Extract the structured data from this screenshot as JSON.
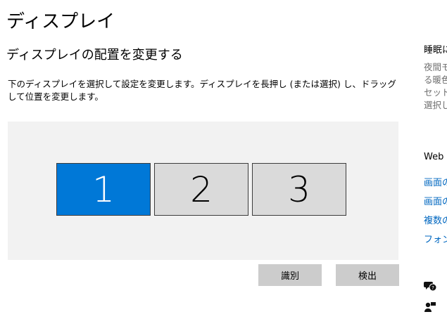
{
  "page": {
    "title": "ディスプレイ",
    "section_title": "ディスプレイの配置を変更する",
    "description": "下のディスプレイを選択して設定を変更します。ディスプレイを長押し (または選択) し、ドラッグして位置を変更します。"
  },
  "displays": [
    {
      "label": "1",
      "selected": true
    },
    {
      "label": "2",
      "selected": false
    },
    {
      "label": "3",
      "selected": false
    }
  ],
  "buttons": {
    "identify": "識別",
    "detect": "検出"
  },
  "sidebar": {
    "sleep_title": "睡眠に",
    "sleep_body": "夜間モ\nる暖色\nセット\n選択し",
    "web_title": "Web",
    "links": [
      "画面の",
      "画面の",
      "複数の",
      "フォント"
    ]
  },
  "colors": {
    "selected": "#0078d7",
    "link": "#0067c0"
  }
}
